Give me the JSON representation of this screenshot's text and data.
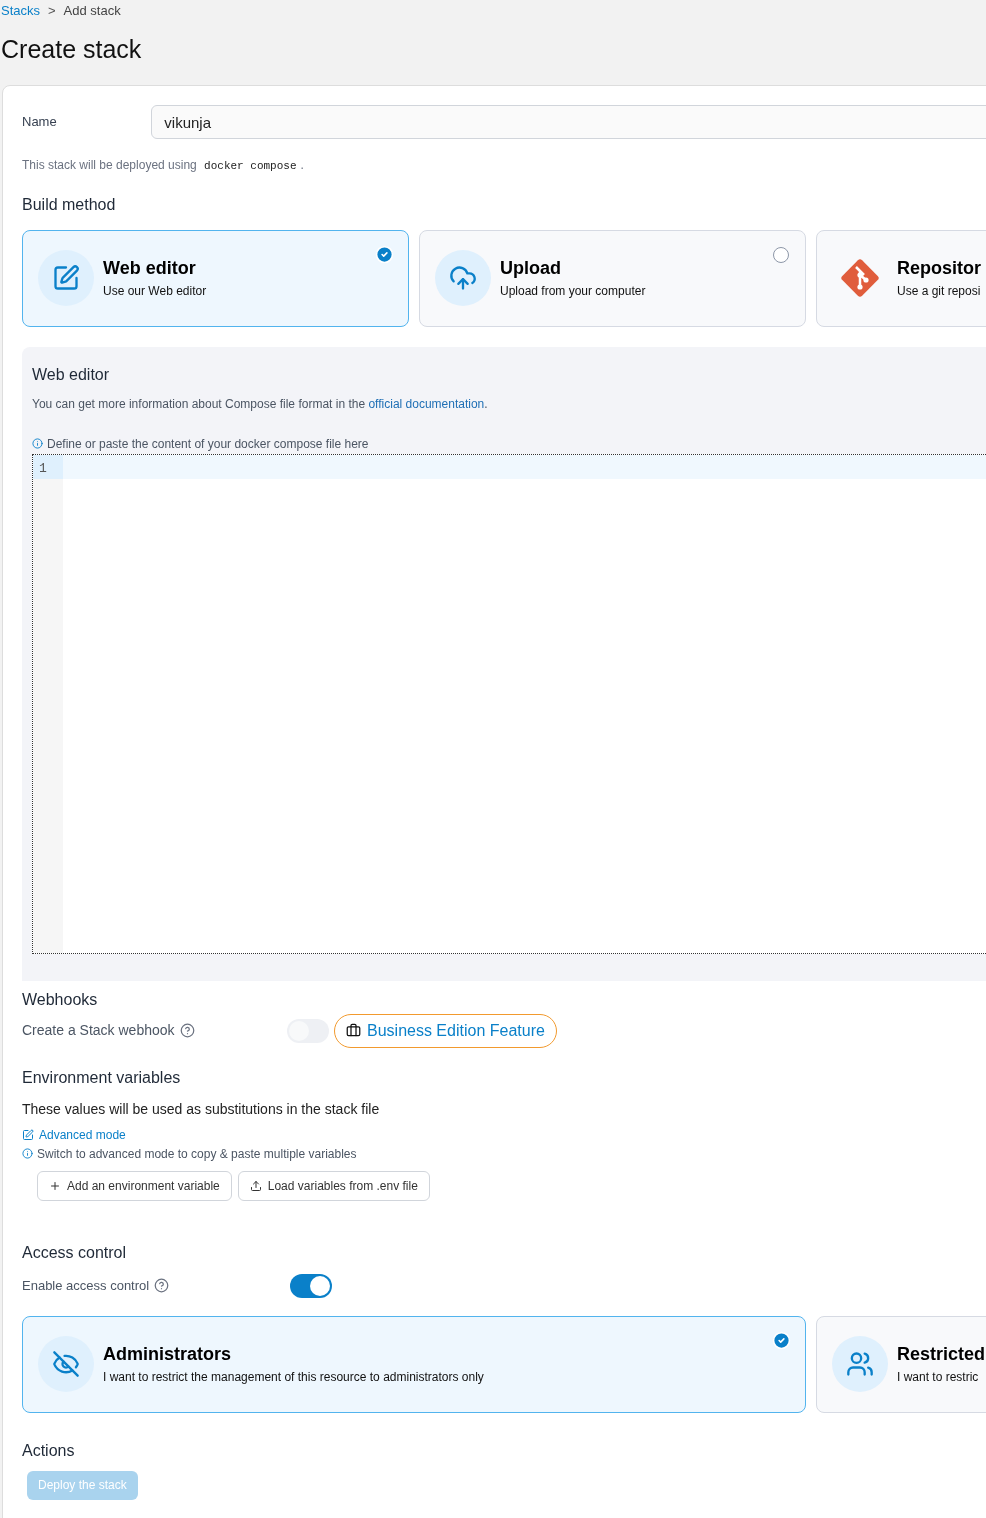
{
  "breadcrumb": {
    "items": [
      {
        "label": "Stacks",
        "kind": "link"
      },
      {
        "label": "Add stack",
        "kind": "current"
      }
    ],
    "separator": ">"
  },
  "title": "Create stack",
  "name_field": {
    "label": "Name",
    "value": "vikunja"
  },
  "deploy_note": {
    "text": "This stack will be deployed using",
    "code": "docker compose",
    "end": "."
  },
  "build_method": {
    "title": "Build method",
    "options": [
      {
        "title": "Web editor",
        "subtitle": "Use our Web editor",
        "selected": true,
        "kind": "editor"
      },
      {
        "title": "Upload",
        "subtitle": "Upload from your computer",
        "selected": false,
        "kind": "upload"
      },
      {
        "title": "Repositor",
        "subtitle": "Use a git reposi",
        "selected": false,
        "kind": "git"
      }
    ]
  },
  "web_editor": {
    "title": "Web editor",
    "info": "You can get more information about Compose file format in the",
    "link": "official documentation",
    "info_end": ".",
    "hint": "Define or paste the content of your docker compose file here",
    "line_numbers": [
      "1"
    ]
  },
  "webhooks": {
    "title": "Webhooks",
    "label": "Create a Stack webhook",
    "on": false,
    "badge": "Business Edition Feature"
  },
  "env": {
    "title": "Environment variables",
    "description": "These values will be used as substitutions in the stack file",
    "advanced_link": "Advanced mode",
    "hint": "Switch to advanced mode to copy & paste multiple variables",
    "buttons": [
      {
        "label": "Add an environment variable",
        "kind": "add"
      },
      {
        "label": "Load variables from .env file",
        "kind": "upload"
      }
    ]
  },
  "access": {
    "title": "Access control",
    "label": "Enable access control",
    "on": true,
    "options": [
      {
        "title": "Administrators",
        "subtitle": "I want to restrict the management of this resource to administrators only",
        "selected": true,
        "kind": "admins"
      },
      {
        "title": "Restricted",
        "subtitle": "I want to restric",
        "selected": false,
        "kind": "restricted"
      }
    ]
  },
  "actions": {
    "title": "Actions",
    "button": {
      "label": "Deploy the stack",
      "disabled": true
    }
  }
}
